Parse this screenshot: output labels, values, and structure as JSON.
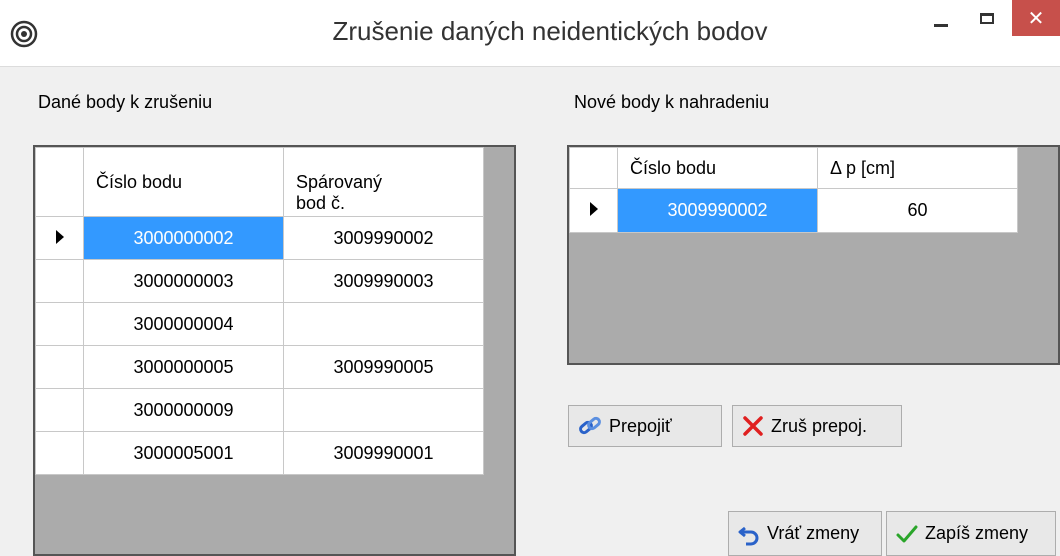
{
  "window": {
    "title": "Zrušenie daných neidentických bodov",
    "close_glyph": "✕"
  },
  "left_panel": {
    "label": "Dané body k zrušeniu",
    "columns": [
      "Číslo bodu",
      "Spárovaný\nbod č."
    ],
    "rows": [
      [
        "3000000002",
        "3009990002"
      ],
      [
        "3000000003",
        "3009990003"
      ],
      [
        "3000000004",
        ""
      ],
      [
        "3000000005",
        "3009990005"
      ],
      [
        "3000000009",
        ""
      ],
      [
        "3000005001",
        "3009990001"
      ]
    ]
  },
  "right_panel": {
    "label": "Nové body k nahradeniu",
    "columns": [
      "Číslo bodu",
      "Δ p [cm]"
    ],
    "rows": [
      [
        "3009990002",
        "60"
      ]
    ]
  },
  "buttons": {
    "relink": "Prepojiť",
    "unlink": "Zruš prepoj.",
    "revert": "Vráť zmeny",
    "save": "Zapíš zmeny"
  },
  "colors": {
    "selection": "#3399ff",
    "grid_bg": "#ababab",
    "close_bg": "#c7504b"
  }
}
